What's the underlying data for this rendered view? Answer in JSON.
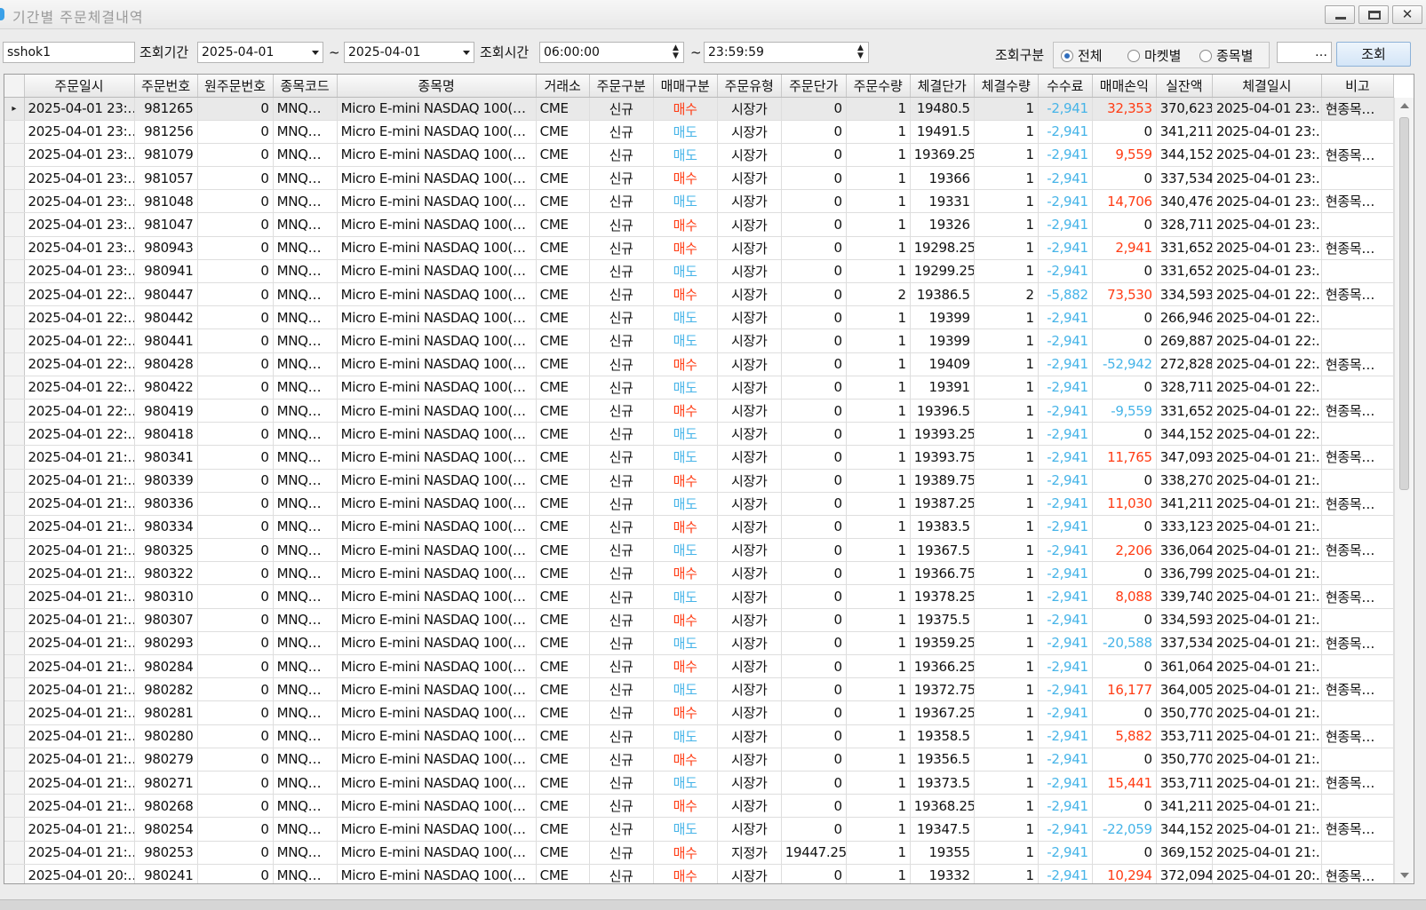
{
  "window": {
    "title": "기간별 주문체결내역",
    "min": "—",
    "max": "□",
    "close": "✕"
  },
  "toolbar": {
    "account": "sshok1",
    "period_label": "조회기간",
    "date_from": "2025-04-01",
    "tilde": "~",
    "date_to": "2025-04-01",
    "time_label": "조회시간",
    "time_from": "06:00:00",
    "time_to": "23:59:59",
    "type_label": "조회구분",
    "radio_all": "전체",
    "radio_market": "마켓별",
    "radio_symbol": "종목별",
    "extra_field": "",
    "ellipsis": "…",
    "query_button": "조회"
  },
  "grid": {
    "headers": [
      "주문일시",
      "주문번호",
      "원주문번호",
      "종목코드",
      "종목명",
      "거래소",
      "주문구분",
      "매매구분",
      "주문유형",
      "주문단가",
      "주문수량",
      "체결단가",
      "체결수량",
      "수수료",
      "매매손익",
      "실잔액",
      "체결일시",
      "비고"
    ],
    "rows": [
      [
        "2025-04-01 23:…",
        "981265",
        "0",
        "MNQ…",
        "Micro E-mini NASDAQ 100(…",
        "CME",
        "신규",
        "매수",
        "시장가",
        "0",
        "1",
        "19480.5",
        "1",
        "-2,941",
        "32,353",
        "370,623",
        "2025-04-01 23:…",
        "현종목…"
      ],
      [
        "2025-04-01 23:…",
        "981256",
        "0",
        "MNQ…",
        "Micro E-mini NASDAQ 100(…",
        "CME",
        "신규",
        "매도",
        "시장가",
        "0",
        "1",
        "19491.5",
        "1",
        "-2,941",
        "0",
        "341,211",
        "2025-04-01 23:…",
        ""
      ],
      [
        "2025-04-01 23:…",
        "981079",
        "0",
        "MNQ…",
        "Micro E-mini NASDAQ 100(…",
        "CME",
        "신규",
        "매도",
        "시장가",
        "0",
        "1",
        "19369.25",
        "1",
        "-2,941",
        "9,559",
        "344,152",
        "2025-04-01 23:…",
        "현종목…"
      ],
      [
        "2025-04-01 23:…",
        "981057",
        "0",
        "MNQ…",
        "Micro E-mini NASDAQ 100(…",
        "CME",
        "신규",
        "매수",
        "시장가",
        "0",
        "1",
        "19366",
        "1",
        "-2,941",
        "0",
        "337,534",
        "2025-04-01 23:…",
        ""
      ],
      [
        "2025-04-01 23:…",
        "981048",
        "0",
        "MNQ…",
        "Micro E-mini NASDAQ 100(…",
        "CME",
        "신규",
        "매도",
        "시장가",
        "0",
        "1",
        "19331",
        "1",
        "-2,941",
        "14,706",
        "340,476",
        "2025-04-01 23:…",
        "현종목…"
      ],
      [
        "2025-04-01 23:…",
        "981047",
        "0",
        "MNQ…",
        "Micro E-mini NASDAQ 100(…",
        "CME",
        "신규",
        "매수",
        "시장가",
        "0",
        "1",
        "19326",
        "1",
        "-2,941",
        "0",
        "328,711",
        "2025-04-01 23:…",
        ""
      ],
      [
        "2025-04-01 23:…",
        "980943",
        "0",
        "MNQ…",
        "Micro E-mini NASDAQ 100(…",
        "CME",
        "신규",
        "매수",
        "시장가",
        "0",
        "1",
        "19298.25",
        "1",
        "-2,941",
        "2,941",
        "331,652",
        "2025-04-01 23:…",
        "현종목…"
      ],
      [
        "2025-04-01 23:…",
        "980941",
        "0",
        "MNQ…",
        "Micro E-mini NASDAQ 100(…",
        "CME",
        "신규",
        "매도",
        "시장가",
        "0",
        "1",
        "19299.25",
        "1",
        "-2,941",
        "0",
        "331,652",
        "2025-04-01 23:…",
        ""
      ],
      [
        "2025-04-01 22:…",
        "980447",
        "0",
        "MNQ…",
        "Micro E-mini NASDAQ 100(…",
        "CME",
        "신규",
        "매수",
        "시장가",
        "0",
        "2",
        "19386.5",
        "2",
        "-5,882",
        "73,530",
        "334,593",
        "2025-04-01 22:…",
        "현종목…"
      ],
      [
        "2025-04-01 22:…",
        "980442",
        "0",
        "MNQ…",
        "Micro E-mini NASDAQ 100(…",
        "CME",
        "신규",
        "매도",
        "시장가",
        "0",
        "1",
        "19399",
        "1",
        "-2,941",
        "0",
        "266,946",
        "2025-04-01 22:…",
        ""
      ],
      [
        "2025-04-01 22:…",
        "980441",
        "0",
        "MNQ…",
        "Micro E-mini NASDAQ 100(…",
        "CME",
        "신규",
        "매도",
        "시장가",
        "0",
        "1",
        "19399",
        "1",
        "-2,941",
        "0",
        "269,887",
        "2025-04-01 22:…",
        ""
      ],
      [
        "2025-04-01 22:…",
        "980428",
        "0",
        "MNQ…",
        "Micro E-mini NASDAQ 100(…",
        "CME",
        "신규",
        "매수",
        "시장가",
        "0",
        "1",
        "19409",
        "1",
        "-2,941",
        "-52,942",
        "272,828",
        "2025-04-01 22:…",
        "현종목…"
      ],
      [
        "2025-04-01 22:…",
        "980422",
        "0",
        "MNQ…",
        "Micro E-mini NASDAQ 100(…",
        "CME",
        "신규",
        "매도",
        "시장가",
        "0",
        "1",
        "19391",
        "1",
        "-2,941",
        "0",
        "328,711",
        "2025-04-01 22:…",
        ""
      ],
      [
        "2025-04-01 22:…",
        "980419",
        "0",
        "MNQ…",
        "Micro E-mini NASDAQ 100(…",
        "CME",
        "신규",
        "매수",
        "시장가",
        "0",
        "1",
        "19396.5",
        "1",
        "-2,941",
        "-9,559",
        "331,652",
        "2025-04-01 22:…",
        "현종목…"
      ],
      [
        "2025-04-01 22:…",
        "980418",
        "0",
        "MNQ…",
        "Micro E-mini NASDAQ 100(…",
        "CME",
        "신규",
        "매도",
        "시장가",
        "0",
        "1",
        "19393.25",
        "1",
        "-2,941",
        "0",
        "344,152",
        "2025-04-01 22:…",
        ""
      ],
      [
        "2025-04-01 21:…",
        "980341",
        "0",
        "MNQ…",
        "Micro E-mini NASDAQ 100(…",
        "CME",
        "신규",
        "매도",
        "시장가",
        "0",
        "1",
        "19393.75",
        "1",
        "-2,941",
        "11,765",
        "347,093",
        "2025-04-01 21:…",
        "현종목…"
      ],
      [
        "2025-04-01 21:…",
        "980339",
        "0",
        "MNQ…",
        "Micro E-mini NASDAQ 100(…",
        "CME",
        "신규",
        "매수",
        "시장가",
        "0",
        "1",
        "19389.75",
        "1",
        "-2,941",
        "0",
        "338,270",
        "2025-04-01 21:…",
        ""
      ],
      [
        "2025-04-01 21:…",
        "980336",
        "0",
        "MNQ…",
        "Micro E-mini NASDAQ 100(…",
        "CME",
        "신규",
        "매도",
        "시장가",
        "0",
        "1",
        "19387.25",
        "1",
        "-2,941",
        "11,030",
        "341,211",
        "2025-04-01 21:…",
        "현종목…"
      ],
      [
        "2025-04-01 21:…",
        "980334",
        "0",
        "MNQ…",
        "Micro E-mini NASDAQ 100(…",
        "CME",
        "신규",
        "매수",
        "시장가",
        "0",
        "1",
        "19383.5",
        "1",
        "-2,941",
        "0",
        "333,123",
        "2025-04-01 21:…",
        ""
      ],
      [
        "2025-04-01 21:…",
        "980325",
        "0",
        "MNQ…",
        "Micro E-mini NASDAQ 100(…",
        "CME",
        "신규",
        "매도",
        "시장가",
        "0",
        "1",
        "19367.5",
        "1",
        "-2,941",
        "2,206",
        "336,064",
        "2025-04-01 21:…",
        "현종목…"
      ],
      [
        "2025-04-01 21:…",
        "980322",
        "0",
        "MNQ…",
        "Micro E-mini NASDAQ 100(…",
        "CME",
        "신규",
        "매수",
        "시장가",
        "0",
        "1",
        "19366.75",
        "1",
        "-2,941",
        "0",
        "336,799",
        "2025-04-01 21:…",
        ""
      ],
      [
        "2025-04-01 21:…",
        "980310",
        "0",
        "MNQ…",
        "Micro E-mini NASDAQ 100(…",
        "CME",
        "신규",
        "매도",
        "시장가",
        "0",
        "1",
        "19378.25",
        "1",
        "-2,941",
        "8,088",
        "339,740",
        "2025-04-01 21:…",
        "현종목…"
      ],
      [
        "2025-04-01 21:…",
        "980307",
        "0",
        "MNQ…",
        "Micro E-mini NASDAQ 100(…",
        "CME",
        "신규",
        "매수",
        "시장가",
        "0",
        "1",
        "19375.5",
        "1",
        "-2,941",
        "0",
        "334,593",
        "2025-04-01 21:…",
        ""
      ],
      [
        "2025-04-01 21:…",
        "980293",
        "0",
        "MNQ…",
        "Micro E-mini NASDAQ 100(…",
        "CME",
        "신규",
        "매도",
        "시장가",
        "0",
        "1",
        "19359.25",
        "1",
        "-2,941",
        "-20,588",
        "337,534",
        "2025-04-01 21:…",
        "현종목…"
      ],
      [
        "2025-04-01 21:…",
        "980284",
        "0",
        "MNQ…",
        "Micro E-mini NASDAQ 100(…",
        "CME",
        "신규",
        "매수",
        "시장가",
        "0",
        "1",
        "19366.25",
        "1",
        "-2,941",
        "0",
        "361,064",
        "2025-04-01 21:…",
        ""
      ],
      [
        "2025-04-01 21:…",
        "980282",
        "0",
        "MNQ…",
        "Micro E-mini NASDAQ 100(…",
        "CME",
        "신규",
        "매도",
        "시장가",
        "0",
        "1",
        "19372.75",
        "1",
        "-2,941",
        "16,177",
        "364,005",
        "2025-04-01 21:…",
        "현종목…"
      ],
      [
        "2025-04-01 21:…",
        "980281",
        "0",
        "MNQ…",
        "Micro E-mini NASDAQ 100(…",
        "CME",
        "신규",
        "매수",
        "시장가",
        "0",
        "1",
        "19367.25",
        "1",
        "-2,941",
        "0",
        "350,770",
        "2025-04-01 21:…",
        ""
      ],
      [
        "2025-04-01 21:…",
        "980280",
        "0",
        "MNQ…",
        "Micro E-mini NASDAQ 100(…",
        "CME",
        "신규",
        "매도",
        "시장가",
        "0",
        "1",
        "19358.5",
        "1",
        "-2,941",
        "5,882",
        "353,711",
        "2025-04-01 21:…",
        "현종목…"
      ],
      [
        "2025-04-01 21:…",
        "980279",
        "0",
        "MNQ…",
        "Micro E-mini NASDAQ 100(…",
        "CME",
        "신규",
        "매수",
        "시장가",
        "0",
        "1",
        "19356.5",
        "1",
        "-2,941",
        "0",
        "350,770",
        "2025-04-01 21:…",
        ""
      ],
      [
        "2025-04-01 21:…",
        "980271",
        "0",
        "MNQ…",
        "Micro E-mini NASDAQ 100(…",
        "CME",
        "신규",
        "매도",
        "시장가",
        "0",
        "1",
        "19373.5",
        "1",
        "-2,941",
        "15,441",
        "353,711",
        "2025-04-01 21:…",
        "현종목…"
      ],
      [
        "2025-04-01 21:…",
        "980268",
        "0",
        "MNQ…",
        "Micro E-mini NASDAQ 100(…",
        "CME",
        "신규",
        "매수",
        "시장가",
        "0",
        "1",
        "19368.25",
        "1",
        "-2,941",
        "0",
        "341,211",
        "2025-04-01 21:…",
        ""
      ],
      [
        "2025-04-01 21:…",
        "980254",
        "0",
        "MNQ…",
        "Micro E-mini NASDAQ 100(…",
        "CME",
        "신규",
        "매도",
        "시장가",
        "0",
        "1",
        "19347.5",
        "1",
        "-2,941",
        "-22,059",
        "344,152",
        "2025-04-01 21:…",
        "현종목…"
      ],
      [
        "2025-04-01 21:…",
        "980253",
        "0",
        "MNQ…",
        "Micro E-mini NASDAQ 100(…",
        "CME",
        "신규",
        "매수",
        "지정가",
        "19447.25",
        "1",
        "19355",
        "1",
        "-2,941",
        "0",
        "369,152",
        "2025-04-01 21:…",
        ""
      ],
      [
        "2025-04-01 20:…",
        "980241",
        "0",
        "MNQ…",
        "Micro E-mini NASDAQ 100(…",
        "CME",
        "신규",
        "매수",
        "시장가",
        "0",
        "1",
        "19332",
        "1",
        "-2,941",
        "10,294",
        "372,094",
        "2025-04-01 20:…",
        "현종목…"
      ]
    ],
    "selected_row": 0,
    "row_pointer": "▸"
  },
  "colors": {
    "buy": "#ff3c14",
    "sell": "#46b4e8",
    "fee": "#46b4e8",
    "profit": "#ff3c14",
    "loss": "#46b4e8"
  }
}
